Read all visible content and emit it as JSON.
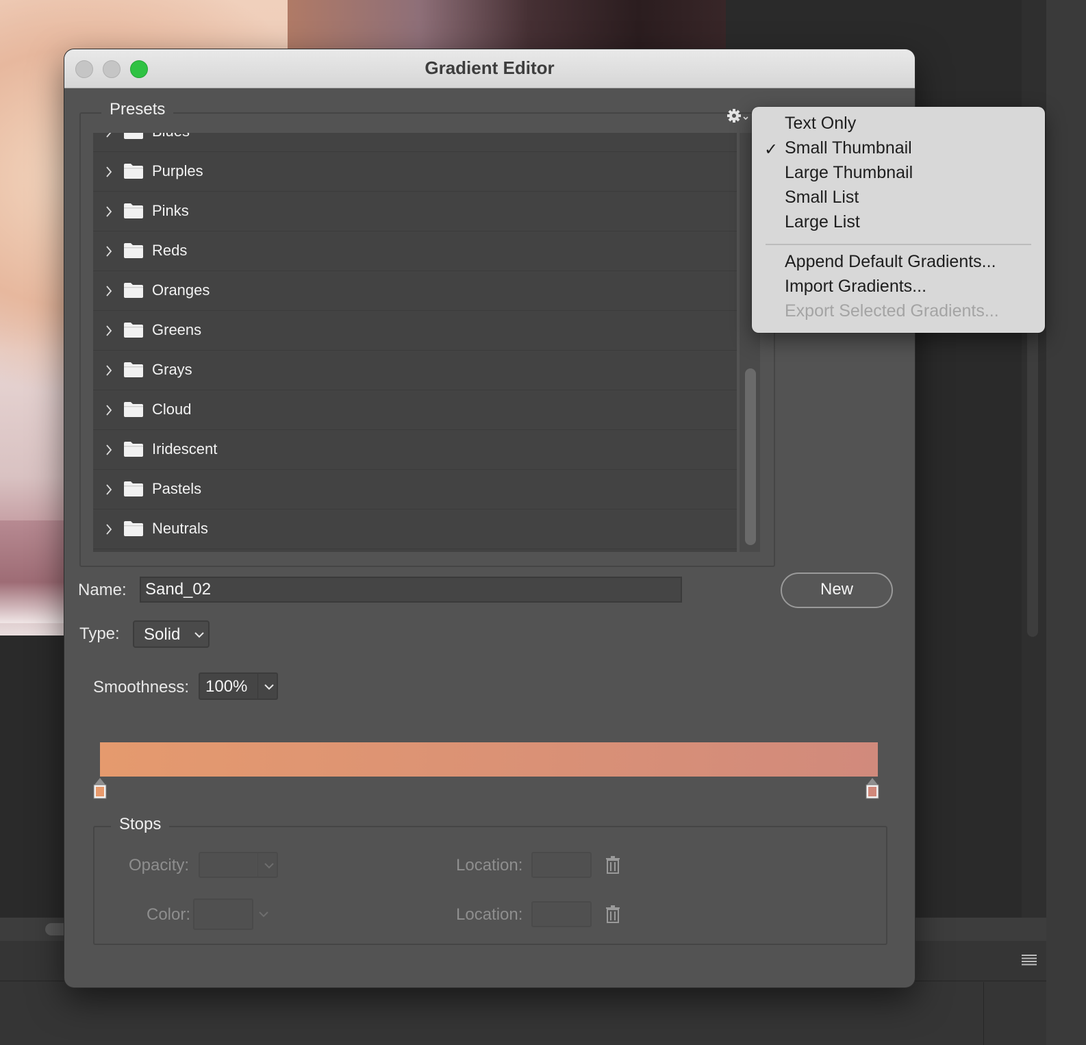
{
  "dialog": {
    "title": "Gradient Editor"
  },
  "presets": {
    "title": "Presets",
    "folders": [
      {
        "label": "Blues"
      },
      {
        "label": "Purples"
      },
      {
        "label": "Pinks"
      },
      {
        "label": "Reds"
      },
      {
        "label": "Oranges"
      },
      {
        "label": "Greens"
      },
      {
        "label": "Grays"
      },
      {
        "label": "Cloud"
      },
      {
        "label": "Iridescent"
      },
      {
        "label": "Pastels"
      },
      {
        "label": "Neutrals"
      }
    ]
  },
  "name_row": {
    "label": "Name:",
    "value": "Sand_02",
    "new_button": "New"
  },
  "type_row": {
    "label": "Type:",
    "value": "Solid"
  },
  "smoothness": {
    "label": "Smoothness:",
    "value": "100%"
  },
  "gradient": {
    "start_color": "#e59a6e",
    "end_color": "#d18a7c",
    "left_stop_color": "#e89a6c",
    "right_stop_color": "#d0887a"
  },
  "stops": {
    "title": "Stops",
    "opacity_label": "Opacity:",
    "color_label": "Color:",
    "location_label_1": "Location:",
    "location_label_2": "Location:"
  },
  "menu": {
    "view_items": [
      {
        "label": "Text Only",
        "checked": false
      },
      {
        "label": "Small Thumbnail",
        "checked": true
      },
      {
        "label": "Large Thumbnail",
        "checked": false
      },
      {
        "label": "Small List",
        "checked": false
      },
      {
        "label": "Large List",
        "checked": false
      }
    ],
    "action_items": [
      {
        "label": "Append Default Gradients...",
        "enabled": true
      },
      {
        "label": "Import Gradients...",
        "enabled": true
      },
      {
        "label": "Export Selected Gradients...",
        "enabled": false
      }
    ],
    "checkmark": "✓"
  },
  "colors": {
    "window_close": "#c5c5c5",
    "window_minimize": "#c5c5c5",
    "window_zoom": "#2fc243",
    "dialog_bg": "#535353"
  },
  "icons": {
    "gear": "gear-icon",
    "folder": "folder-icon",
    "chevron": "chevron-right-icon",
    "trash": "trash-icon",
    "panel_menu": "hamburger-menu-icon"
  }
}
